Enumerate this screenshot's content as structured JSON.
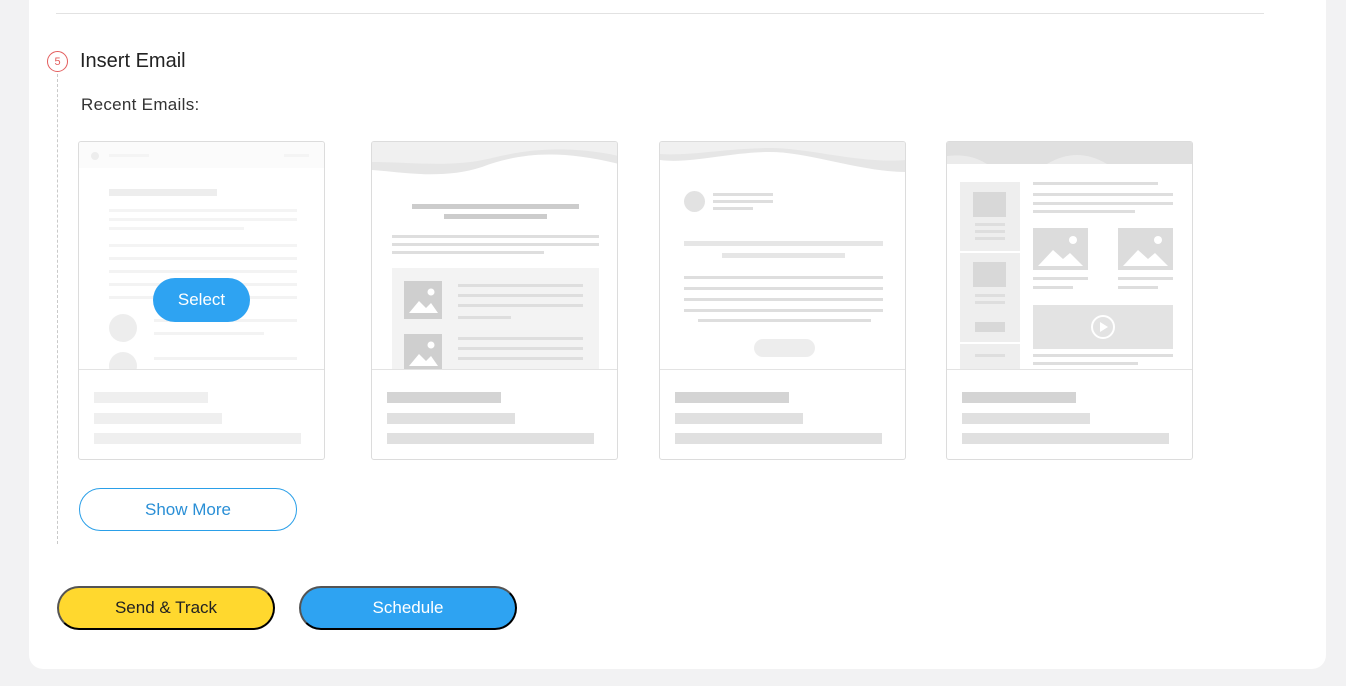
{
  "step": {
    "number": "5",
    "title": "Insert Email"
  },
  "recent_label": "Recent Emails:",
  "cards": [
    {
      "name": "template-1",
      "hover_action": "Select"
    },
    {
      "name": "template-2"
    },
    {
      "name": "template-3"
    },
    {
      "name": "template-4"
    }
  ],
  "buttons": {
    "select": "Select",
    "show_more": "Show More",
    "send_track": "Send & Track",
    "schedule": "Schedule"
  },
  "colors": {
    "primary": "#2ea3f2",
    "accent": "#ffd82e",
    "step_badge": "#e35d5d"
  },
  "icons": [
    "image-placeholder-icon",
    "play-icon"
  ]
}
